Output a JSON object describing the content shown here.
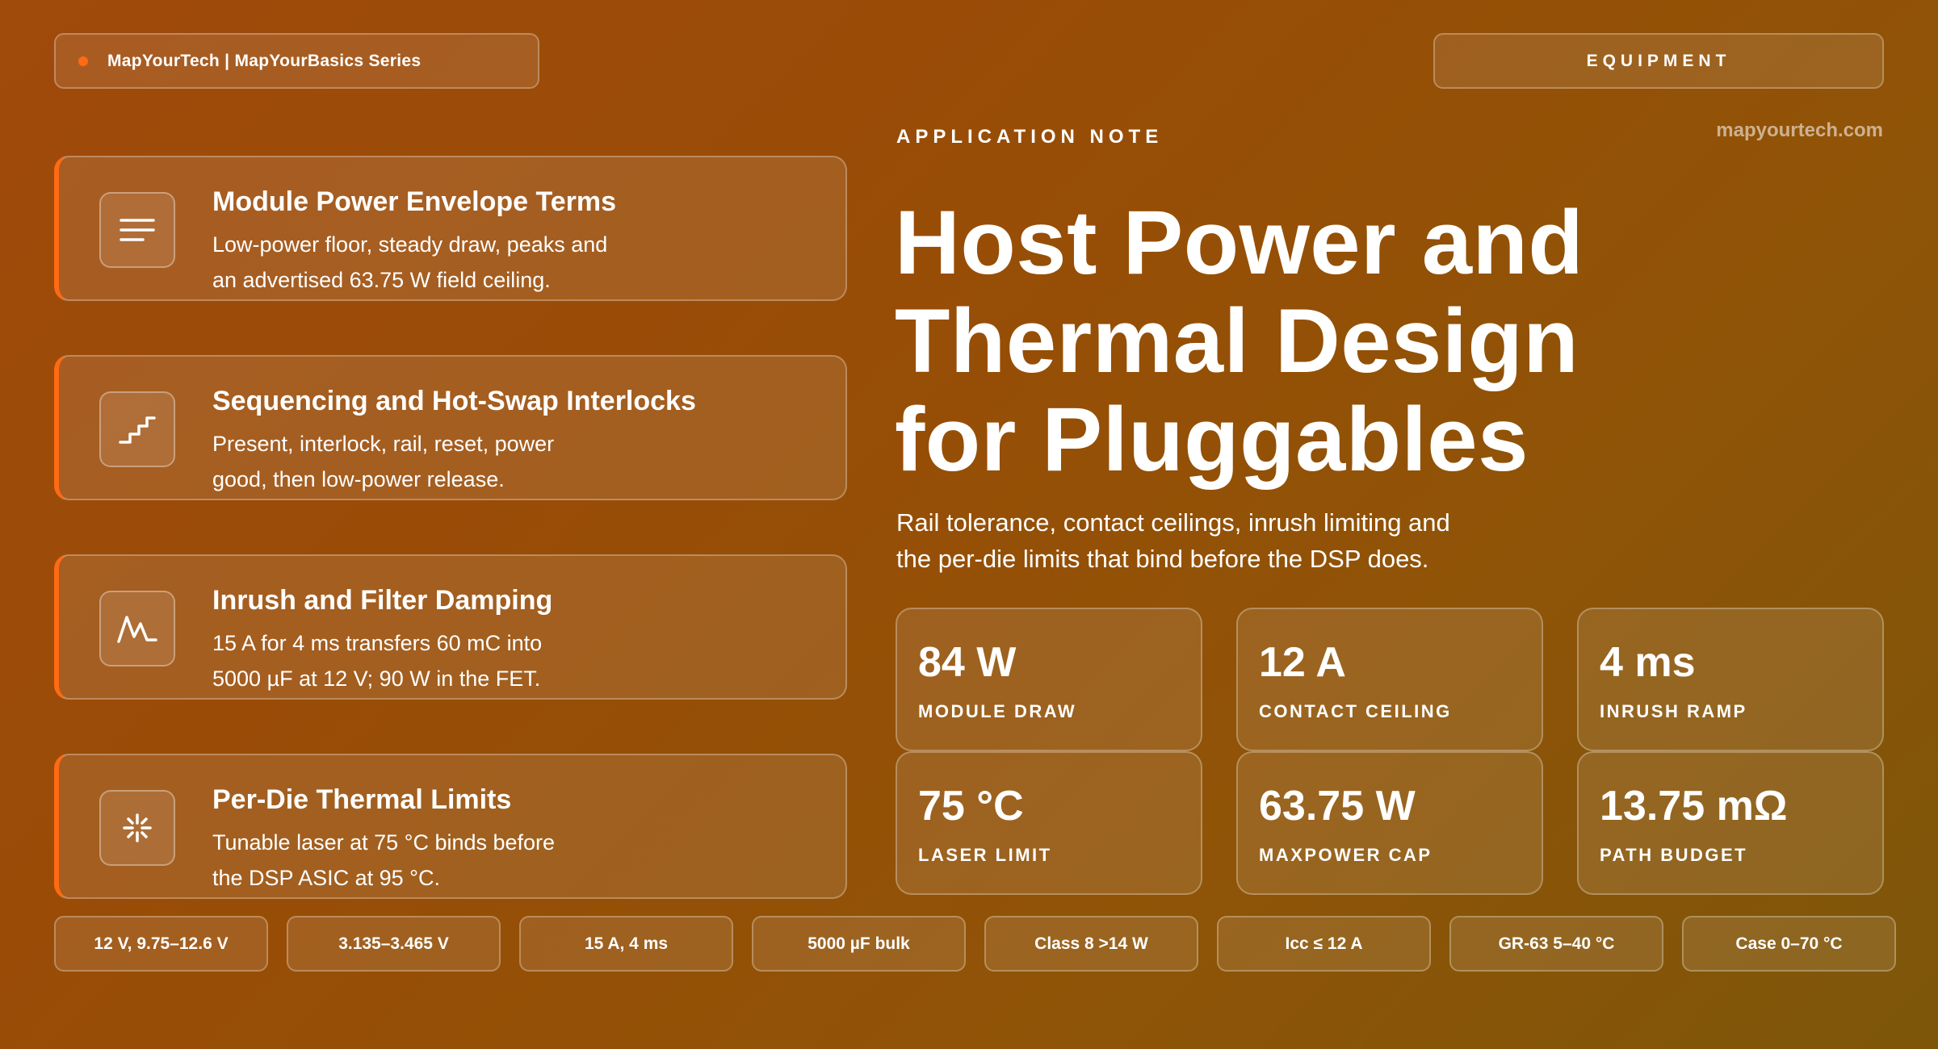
{
  "header": {
    "brand": "MapYourTech | MapYourBasics Series",
    "category": "EQUIPMENT",
    "site": "mapyourtech.com",
    "accent_color": "#ff6a14"
  },
  "hero": {
    "eyebrow": "APPLICATION NOTE",
    "title_lines": [
      "Host Power and",
      "Thermal Design",
      "for Pluggables"
    ],
    "subtitle_lines": [
      "Rail tolerance, contact ceilings, inrush limiting and",
      "the per-die limits that bind before the DSP does."
    ]
  },
  "cards": [
    {
      "icon": "lines-icon",
      "title": "Module Power Envelope Terms",
      "desc": [
        "Low-power floor, steady draw, peaks and",
        "an advertised 63.75 W field ceiling."
      ]
    },
    {
      "icon": "stairs-icon",
      "title": "Sequencing and Hot-Swap Interlocks",
      "desc": [
        "Present, interlock, rail, reset, power",
        "good, then low-power release."
      ]
    },
    {
      "icon": "waveform-icon",
      "title": "Inrush and Filter Damping",
      "desc": [
        "15 A for 4 ms transfers 60 mC into",
        "5000 µF at 12 V; 90 W in the FET."
      ]
    },
    {
      "icon": "burst-icon",
      "title": "Per-Die Thermal Limits",
      "desc": [
        "Tunable laser at 75 °C binds before",
        "the DSP ASIC at 95 °C."
      ]
    }
  ],
  "stats": [
    {
      "value": "84 W",
      "label": "MODULE DRAW"
    },
    {
      "value": "12 A",
      "label": "CONTACT CEILING"
    },
    {
      "value": "4 ms",
      "label": "INRUSH RAMP"
    },
    {
      "value": "75 °C",
      "label": "LASER LIMIT"
    },
    {
      "value": "63.75 W",
      "label": "MAXPOWER CAP"
    },
    {
      "value": "13.75 mΩ",
      "label": "PATH BUDGET"
    }
  ],
  "chips": [
    "12 V, 9.75–12.6 V",
    "3.135–3.465 V",
    "15 A, 4 ms",
    "5000 µF bulk",
    "Class 8 >14 W",
    "Icc ≤ 12 A",
    "GR-63 5–40 °C",
    "Case 0–70 °C"
  ]
}
